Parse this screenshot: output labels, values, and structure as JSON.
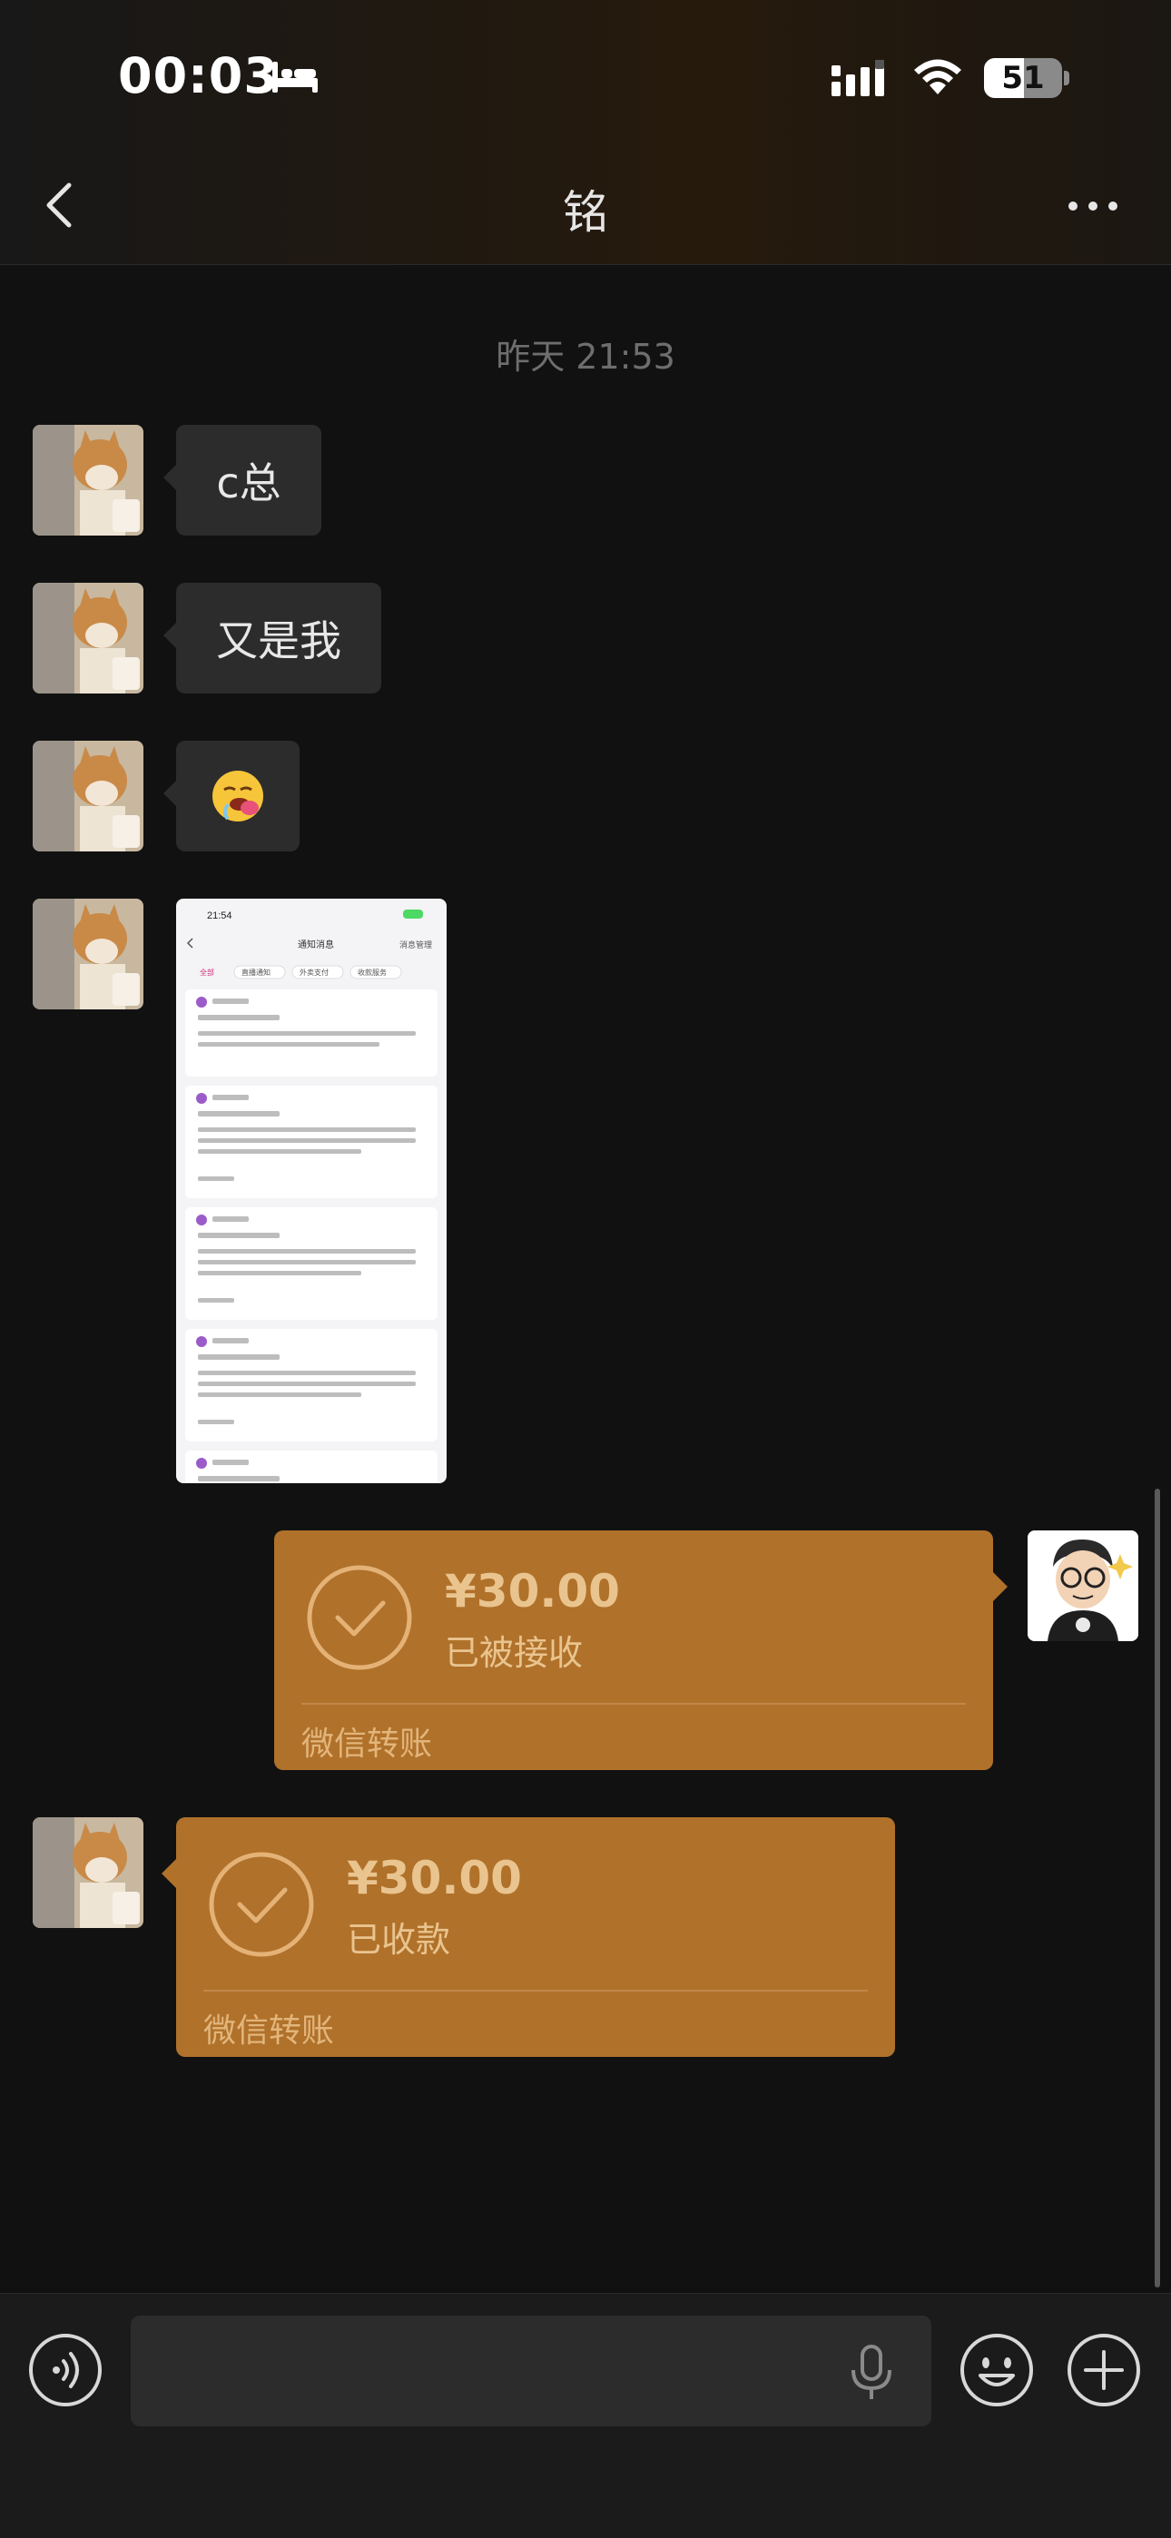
{
  "status_bar": {
    "time": "00:03",
    "battery": "51",
    "battery_level": 0.51
  },
  "header": {
    "title": "铭",
    "back_icon": "chevron-left-icon",
    "more_icon": "more-dots-icon"
  },
  "chat": {
    "time_divider": "昨天 21:53",
    "messages": [
      {
        "side": "left",
        "type": "text",
        "text": "c总"
      },
      {
        "side": "left",
        "type": "text",
        "text": "又是我"
      },
      {
        "side": "left",
        "type": "emoji",
        "icon": "drooling-face-emoji"
      },
      {
        "side": "left",
        "type": "image",
        "description": "screenshot-thumbnail"
      },
      {
        "side": "right",
        "type": "transfer",
        "amount": "¥30.00",
        "status": "已被接收",
        "footer": "微信转账"
      },
      {
        "side": "left",
        "type": "transfer",
        "amount": "¥30.00",
        "status": "已收款",
        "footer": "微信转账"
      }
    ],
    "thumbnail": {
      "time": "21:54",
      "title": "通知消息",
      "right_action": "消息管理",
      "tabs": [
        "全部",
        "直播通知",
        "外卖支付",
        "收款服务"
      ]
    }
  },
  "input_bar": {
    "placeholder": "",
    "voice_icon": "voice-wave-icon",
    "mic_icon": "microphone-icon",
    "emoji_icon": "emoji-icon",
    "plus_icon": "plus-icon"
  },
  "colors": {
    "background": "#111111",
    "bubble": "#2c2c2c",
    "transfer": "#b0712a",
    "transfer_text": "#e9c48f"
  }
}
